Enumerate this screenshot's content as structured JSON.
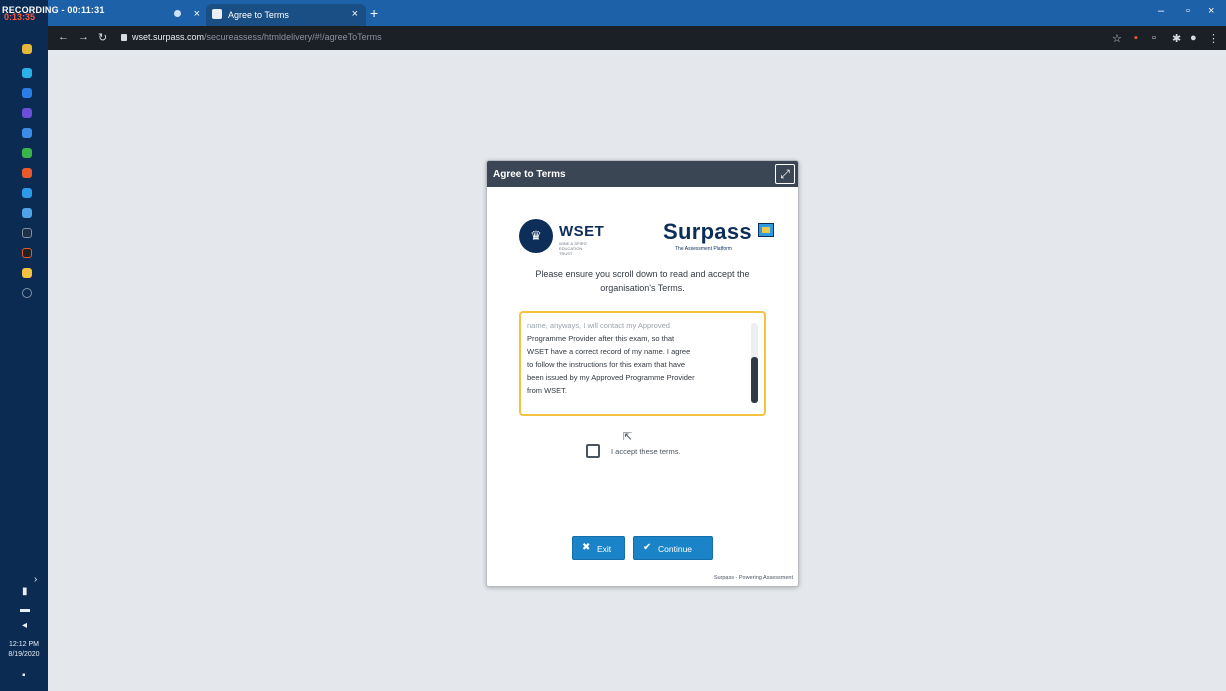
{
  "recording": {
    "label": "RECORDING - 00:11:31"
  },
  "taskbar": {
    "top_label": "0:13:35",
    "clock_time": "12:12 PM",
    "clock_date": "8/19/2020"
  },
  "browser": {
    "tabs": [
      {
        "label": ""
      },
      {
        "label": "Agree to Terms"
      }
    ],
    "url_host": "wset.surpass.com",
    "url_path": "/secureassess/htmldelivery/#!/agreeToTerms"
  },
  "dialog": {
    "title": "Agree to Terms",
    "wset_word": "WSET",
    "wset_sub": "WINE & SPIRIT EDUCATION TRUST",
    "surpass_word": "Surpass",
    "surpass_tag": "The Assessment Platform",
    "instruction": "Please ensure you scroll down to read and accept the organisation's Terms.",
    "terms_line_faded": "name, anyways, I will contact my Approved",
    "terms_lines": [
      "Programme Provider after this exam, so that",
      "WSET have a correct record of my name. I agree",
      "to follow the instructions for this exam that have",
      "been issued by my Approved Programme Provider",
      "from WSET."
    ],
    "accept_label": "I accept these terms.",
    "exit_label": "Exit",
    "continue_label": "Continue",
    "footer": "Surpass - Powering Assessment"
  },
  "colors": {
    "header": "#3a4653",
    "button": "#1b84c9",
    "terms_border": "#f3c340",
    "titlebar": "#1d62a8"
  }
}
